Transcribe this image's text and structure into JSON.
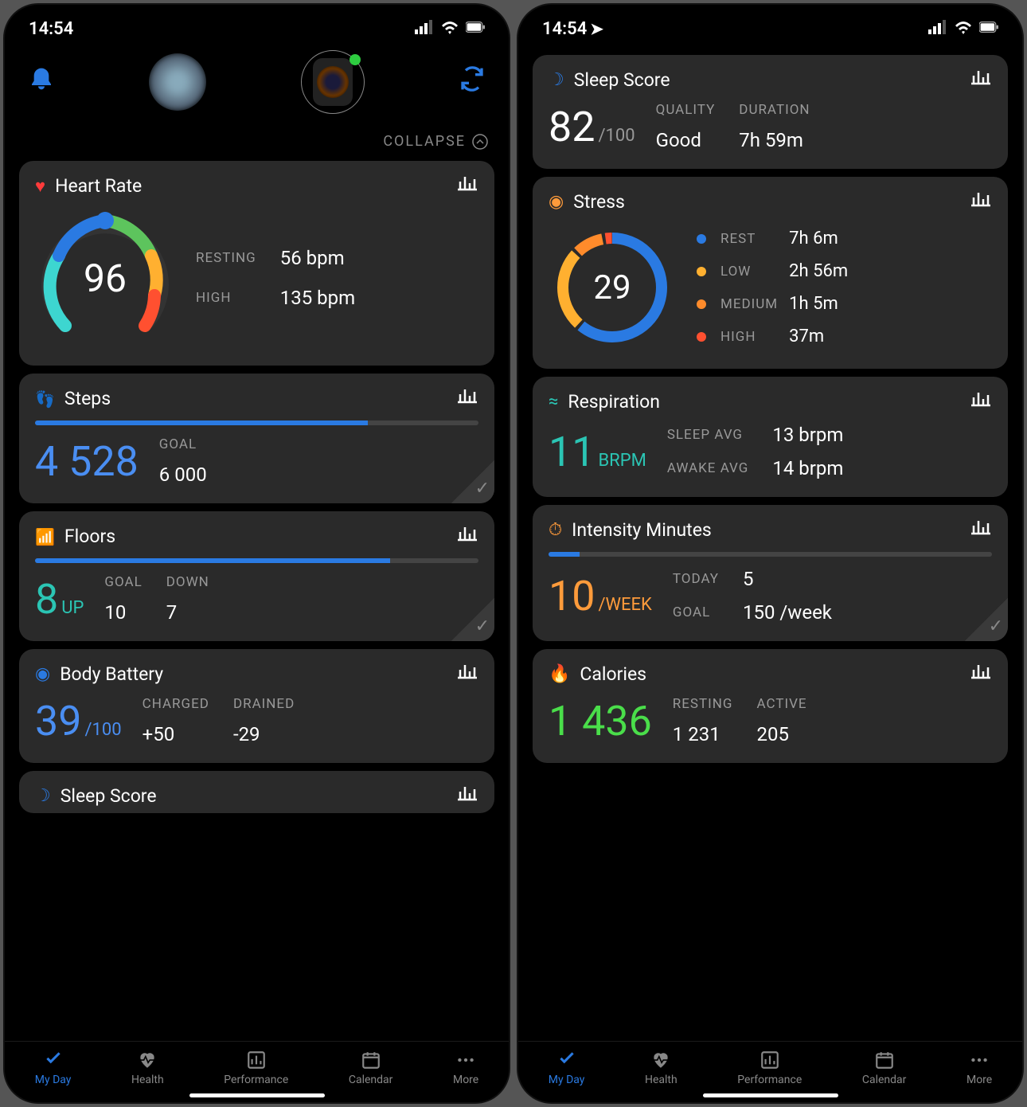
{
  "status": {
    "time": "14:54",
    "showLocation": true
  },
  "collapse_label": "COLLAPSE",
  "cards": {
    "heart_rate": {
      "title": "Heart Rate",
      "value": "96",
      "resting_label": "RESTING",
      "resting_val": "56 bpm",
      "high_label": "HIGH",
      "high_val": "135 bpm"
    },
    "steps": {
      "title": "Steps",
      "value": "4 528",
      "goal_label": "GOAL",
      "goal_val": "6 000",
      "progress_pct": 75
    },
    "floors": {
      "title": "Floors",
      "value": "8",
      "value_unit": "UP",
      "goal_label": "GOAL",
      "goal_val": "10",
      "down_label": "DOWN",
      "down_val": "7",
      "progress_pct": 80
    },
    "body_battery": {
      "title": "Body Battery",
      "value": "39",
      "value_unit": "/100",
      "charged_label": "CHARGED",
      "charged_val": "+50",
      "drained_label": "DRAINED",
      "drained_val": "-29"
    },
    "sleep": {
      "title": "Sleep Score",
      "value": "82",
      "value_unit": "/100",
      "quality_label": "QUALITY",
      "quality_val": "Good",
      "duration_label": "DURATION",
      "duration_val": "7h 59m"
    },
    "stress": {
      "title": "Stress",
      "value": "29",
      "rest_label": "REST",
      "rest_val": "7h 6m",
      "low_label": "LOW",
      "low_val": "2h 56m",
      "medium_label": "MEDIUM",
      "medium_val": "1h 5m",
      "high_label": "HIGH",
      "high_val": "37m"
    },
    "respiration": {
      "title": "Respiration",
      "value": "11",
      "value_unit": "BRPM",
      "sleep_label": "SLEEP AVG",
      "sleep_val": "13 brpm",
      "awake_label": "AWAKE AVG",
      "awake_val": "14 brpm"
    },
    "intensity": {
      "title": "Intensity Minutes",
      "value": "10",
      "value_unit": "/WEEK",
      "today_label": "TODAY",
      "today_val": "5",
      "goal_label": "GOAL",
      "goal_val": "150 /week",
      "progress_pct": 7
    },
    "calories": {
      "title": "Calories",
      "value": "1 436",
      "resting_label": "RESTING",
      "resting_val": "1 231",
      "active_label": "ACTIVE",
      "active_val": "205"
    }
  },
  "nav": {
    "myday": "My Day",
    "health": "Health",
    "performance": "Performance",
    "calendar": "Calendar",
    "more": "More"
  }
}
